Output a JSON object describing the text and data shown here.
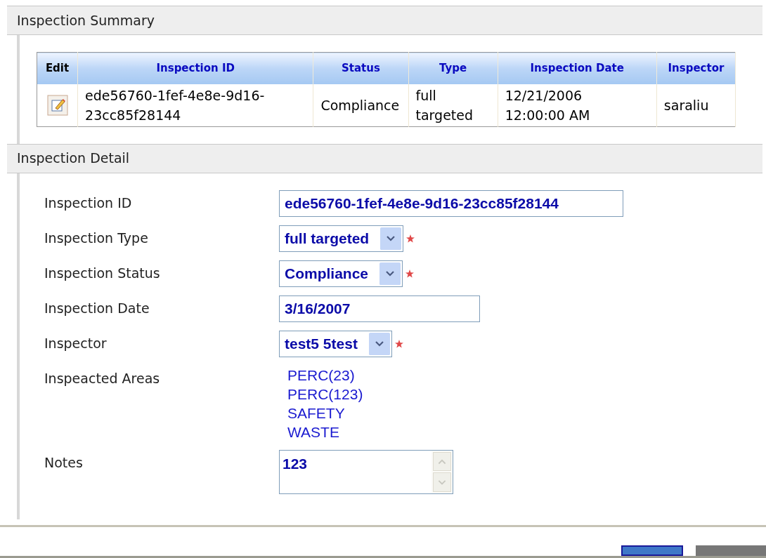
{
  "summary": {
    "title": "Inspection Summary",
    "table": {
      "columns": [
        "Edit",
        "Inspection ID",
        "Status",
        "Type",
        "Inspection Date",
        "Inspector"
      ],
      "rows": [
        {
          "id": "ede56760-1fef-4e8e-9d16-23cc85f28144",
          "status": "Compliance",
          "type": "full targeted",
          "date": "12/21/2006 12:00:00 AM",
          "inspector": "saraliu"
        }
      ]
    }
  },
  "detail": {
    "title": "Inspection Detail",
    "fields": [
      {
        "label": "Inspection ID",
        "kind": "text",
        "value": "ede56760-1fef-4e8e-9d16-23cc85f28144",
        "required": false
      },
      {
        "label": "Inspection Type",
        "kind": "select",
        "value": "full targeted",
        "required": true
      },
      {
        "label": "Inspection Status",
        "kind": "select",
        "value": "Compliance",
        "required": true
      },
      {
        "label": "Inspection Date",
        "kind": "text",
        "value": "3/16/2007",
        "required": false
      },
      {
        "label": "Inspector",
        "kind": "select",
        "value": "test5 5test",
        "required": true
      },
      {
        "label": "Inspeacted Areas",
        "kind": "list",
        "items": [
          "PERC(23)",
          "PERC(123)",
          "SAFETY",
          "WASTE"
        ]
      },
      {
        "label": "Notes",
        "kind": "textarea",
        "value": "123"
      }
    ]
  },
  "footer_buttons": [
    {
      "kind": "primary"
    },
    {
      "kind": "secondary"
    }
  ]
}
